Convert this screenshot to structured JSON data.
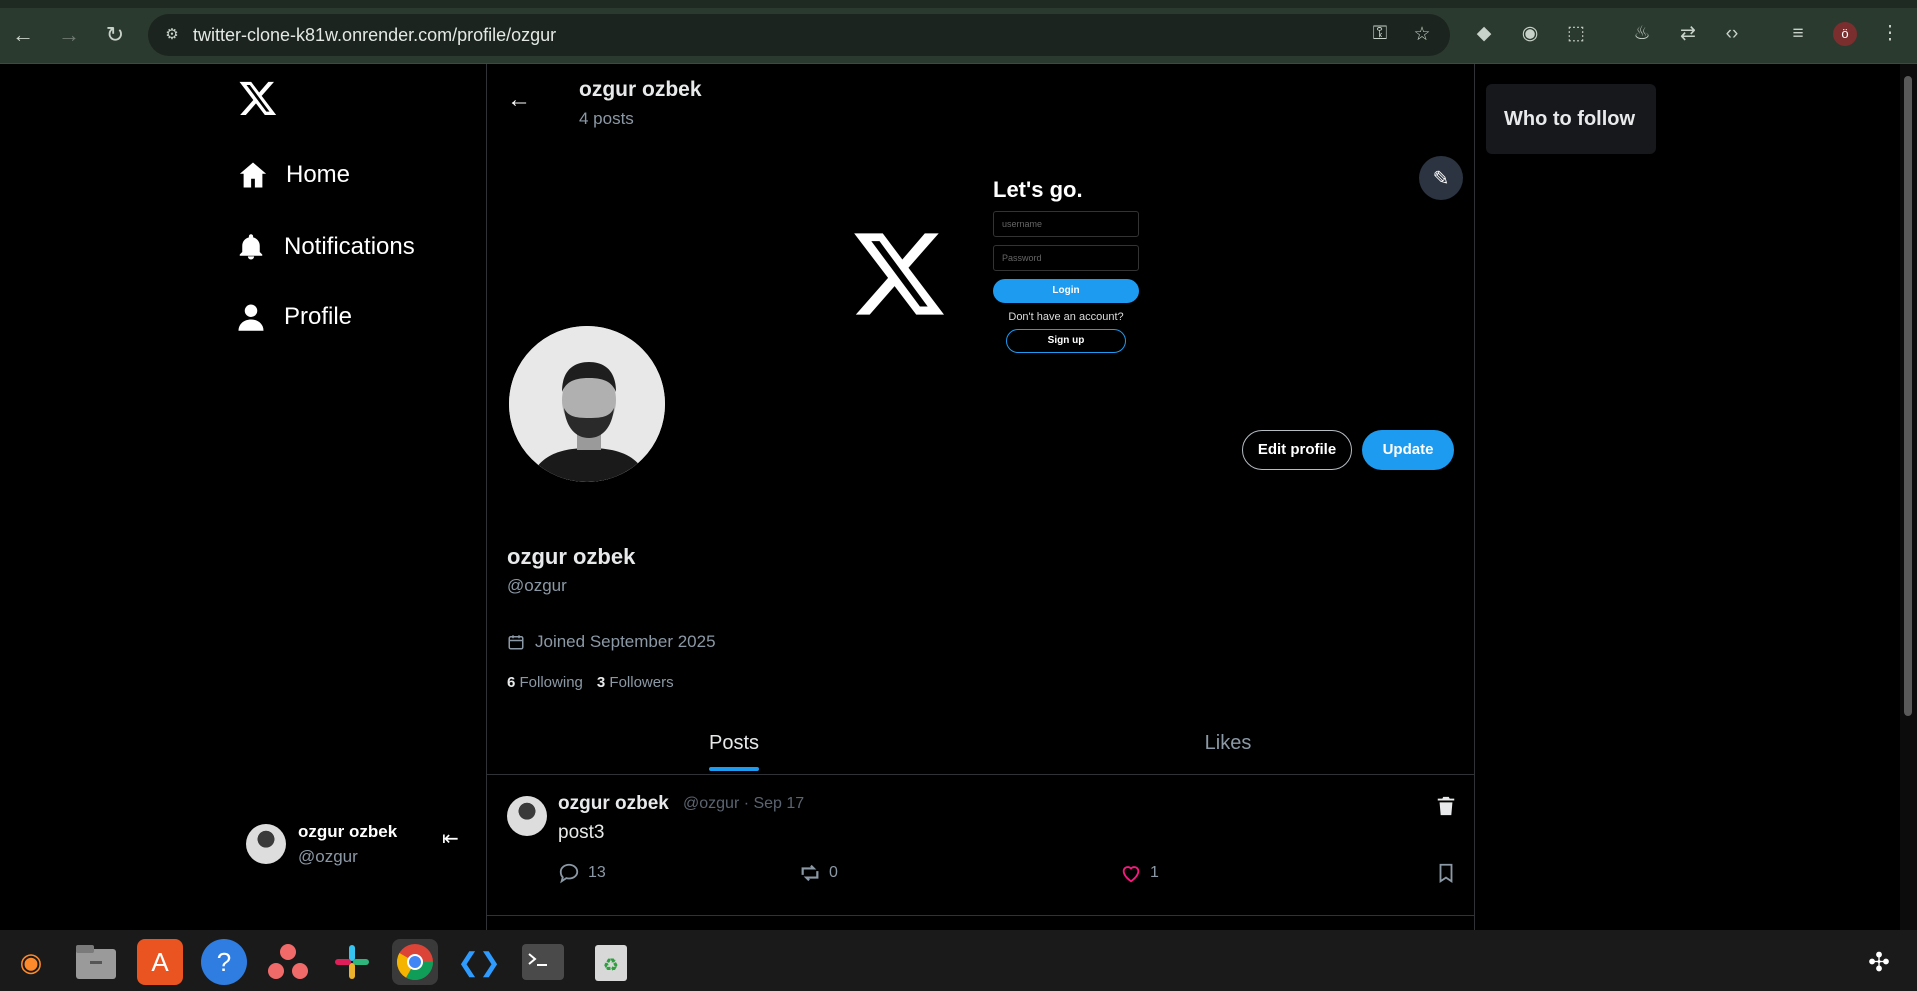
{
  "browser": {
    "url": "twitter-clone-k81w.onrender.com/profile/ozgur",
    "profile_initial": "ö"
  },
  "sidebar": {
    "nav": [
      {
        "label": "Home"
      },
      {
        "label": "Notifications"
      },
      {
        "label": "Profile"
      }
    ],
    "current_user": {
      "name": "ozgur ozbek",
      "handle": "@ozgur"
    }
  },
  "header": {
    "name": "ozgur ozbek",
    "posts_count": "4 posts"
  },
  "cover": {
    "heading": "Let's go.",
    "username_placeholder": "username",
    "password_placeholder": "Password",
    "login_label": "Login",
    "question": "Don't have an account?",
    "signup_label": "Sign up"
  },
  "profile": {
    "edit_label": "Edit profile",
    "update_label": "Update",
    "name": "ozgur ozbek",
    "handle": "@ozgur",
    "joined": "Joined September 2025",
    "following_count": "6",
    "following_label": "Following",
    "followers_count": "3",
    "followers_label": "Followers"
  },
  "tabs": [
    {
      "label": "Posts"
    },
    {
      "label": "Likes"
    }
  ],
  "posts": [
    {
      "name": "ozgur ozbek",
      "meta": "@ozgur · Sep 17",
      "text": "post3",
      "comments": "13",
      "reposts": "0",
      "likes": "1"
    }
  ],
  "right": {
    "who_to_follow": "Who to follow"
  },
  "colors": {
    "accent": "#1d9bf0",
    "like": "#f91880",
    "background": "#000000"
  }
}
